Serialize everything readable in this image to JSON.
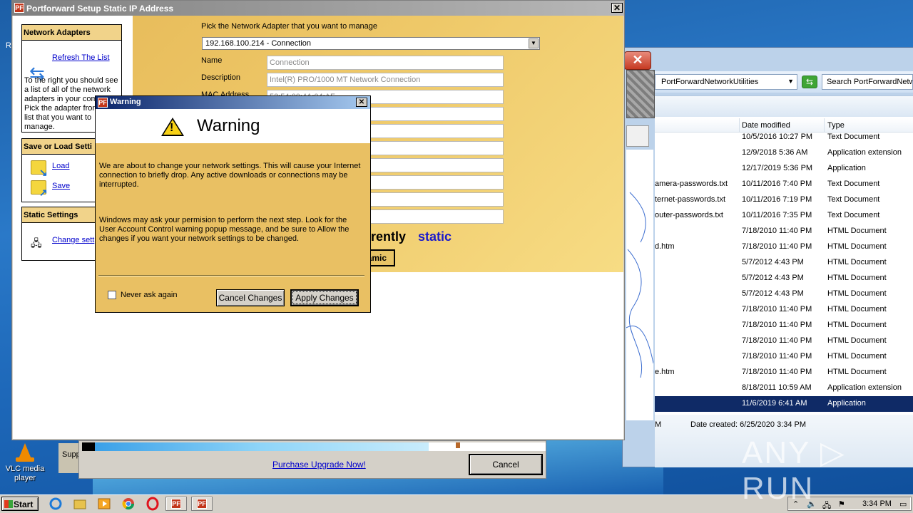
{
  "desktop": {
    "left_letter": "R",
    "vlc_label": "VLC media player",
    "partial_label": "Supp"
  },
  "explorer": {
    "path": "PortForwardNetworkUtilities",
    "search_placeholder": "Search PortForwardNetw",
    "columns": [
      "Date modified",
      "Type"
    ],
    "rows": [
      {
        "name": "",
        "date": "10/5/2016 10:27 PM",
        "type": "Text Document"
      },
      {
        "name": "",
        "date": "12/9/2018 5:36 AM",
        "type": "Application extension"
      },
      {
        "name": "",
        "date": "12/17/2019 5:36 PM",
        "type": "Application"
      },
      {
        "name": "amera-passwords.txt",
        "date": "10/11/2016 7:40 PM",
        "type": "Text Document"
      },
      {
        "name": "ternet-passwords.txt",
        "date": "10/11/2016 7:19 PM",
        "type": "Text Document"
      },
      {
        "name": "outer-passwords.txt",
        "date": "10/11/2016 7:35 PM",
        "type": "Text Document"
      },
      {
        "name": "",
        "date": "7/18/2010 11:40 PM",
        "type": "HTML Document"
      },
      {
        "name": "d.htm",
        "date": "7/18/2010 11:40 PM",
        "type": "HTML Document"
      },
      {
        "name": "",
        "date": "5/7/2012 4:43 PM",
        "type": "HTML Document"
      },
      {
        "name": "",
        "date": "5/7/2012 4:43 PM",
        "type": "HTML Document"
      },
      {
        "name": "",
        "date": "5/7/2012 4:43 PM",
        "type": "HTML Document"
      },
      {
        "name": "",
        "date": "7/18/2010 11:40 PM",
        "type": "HTML Document"
      },
      {
        "name": "",
        "date": "7/18/2010 11:40 PM",
        "type": "HTML Document"
      },
      {
        "name": "",
        "date": "7/18/2010 11:40 PM",
        "type": "HTML Document"
      },
      {
        "name": "",
        "date": "7/18/2010 11:40 PM",
        "type": "HTML Document"
      },
      {
        "name": "e.htm",
        "date": "7/18/2010 11:40 PM",
        "type": "HTML Document"
      },
      {
        "name": "",
        "date": "8/18/2011 10:59 AM",
        "type": "Application extension"
      },
      {
        "name": "",
        "date": "11/6/2019 6:41 AM",
        "type": "Application"
      }
    ],
    "status_left": "M",
    "status_created": "Date created: 6/25/2020 3:34 PM"
  },
  "pf_window": {
    "title": "Portforward Setup Static IP Address",
    "close": "✕",
    "network_adapters": {
      "header": "Network Adapters",
      "refresh_link": "Refresh The List",
      "help_lines": [
        "To the right you should see",
        "a list of all of the network",
        "adapters in your com",
        "Pick the adapter fron",
        "list that you want to",
        "manage."
      ]
    },
    "save_load": {
      "header": "Save or Load Setti",
      "load": "Load",
      "save": "Save"
    },
    "static_settings": {
      "header": "Static Settings",
      "change_link": "Change sett"
    },
    "adapter_prompt": "Pick the Network Adapter that you want to manage",
    "adapter_selected": "192.168.100.214 - Connection",
    "fields": {
      "name_label": "Name",
      "name_value": "Connection",
      "desc_label": "Description",
      "desc_value": "Intel(R) PRO/1000 MT Network Connection",
      "mac_label": "MAC Address",
      "mac_value": "52:54:00:4A:04:AF"
    },
    "currently_text": "rently",
    "static_text": "static",
    "dynamic_btn": "amic"
  },
  "warning": {
    "title": "Warning",
    "close": "✕",
    "heading": "Warning",
    "para1": "We are about to change your network settings. This will cause your Internet connection to briefly drop. Any active downloads or connections may be interrupted.",
    "para2": "Windows may ask your permision to perform the next step. Look for the User Account Control warning popup message, and be sure to Allow the changes if you want your network settings to be changed.",
    "never_ask": "Never ask again",
    "cancel": "Cancel Changes",
    "apply": "Apply Changes"
  },
  "under_dialog": {
    "purchase": "Purchase Upgrade Now!",
    "cancel": "Cancel"
  },
  "taskbar": {
    "start": "Start",
    "clock": "3:34 PM"
  },
  "watermark": "ANY ▷ RUN"
}
